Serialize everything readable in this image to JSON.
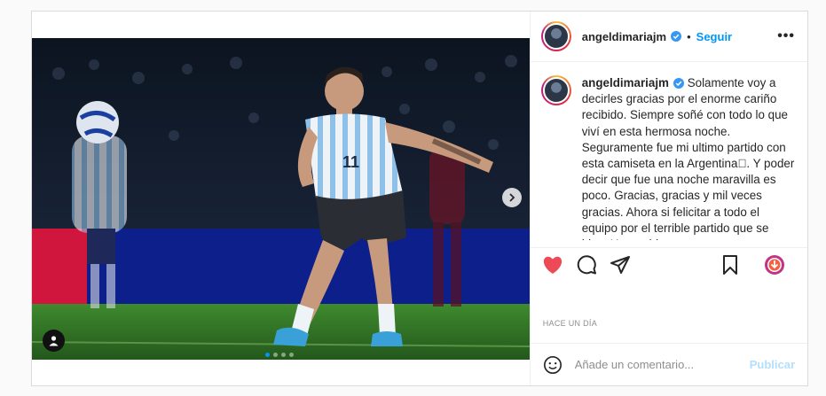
{
  "post": {
    "username": "angeldimariajm",
    "separator": "•",
    "follow_label": "Seguir",
    "more_label": "•••",
    "caption_text": "Solamente voy a decirles gracias por el enorme cariño recibido. Siempre soñé con todo lo que viví en esta hermosa noche. Seguramente fue mi ultimo partido con esta camiseta en la Argentina\u0000. Y poder decir que fue una noche maravilla es poco. Gracias, gracias y mil veces gracias. Ahora si felicitar a todo el equipo por el terrible partido que se hizo. Un partido",
    "timestamp": "HACE UN DÍA",
    "comment_placeholder": "Añade un comentario...",
    "publish_label": "Publicar",
    "carousel": {
      "slide_count": 4,
      "active_index": 0
    },
    "jersey_number": "11",
    "colors": {
      "accent": "#0095f6",
      "like": "#ed4956",
      "publish_disabled": "#b2dffc",
      "verified": "#3897f0"
    },
    "icons": [
      "verified-badge-icon",
      "heart-icon",
      "comment-icon",
      "share-icon",
      "bookmark-icon",
      "promo-icon",
      "emoji-icon",
      "user-tag-icon",
      "chevron-right-icon"
    ]
  }
}
